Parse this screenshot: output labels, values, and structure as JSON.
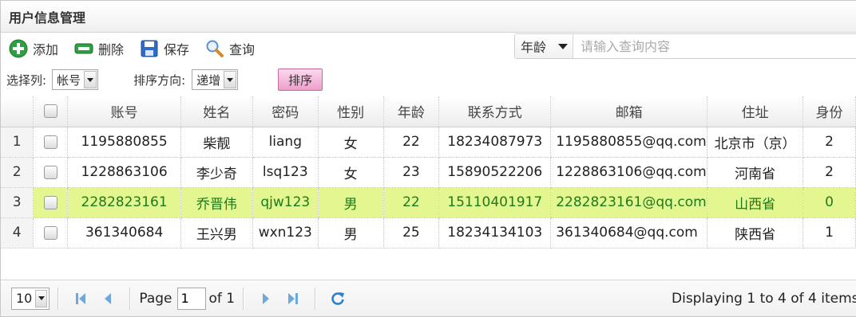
{
  "panel": {
    "title": "用户信息管理"
  },
  "toolbar": {
    "add_label": "添加",
    "delete_label": "删除",
    "save_label": "保存",
    "query_label": "查询"
  },
  "search": {
    "field_value": "年龄",
    "placeholder": "请输入查询内容"
  },
  "sortbar": {
    "column_label": "选择列:",
    "column_value": "帐号",
    "direction_label": "排序方向:",
    "direction_value": "递增",
    "sort_button": "排序"
  },
  "grid": {
    "columns": [
      "账号",
      "姓名",
      "密码",
      "性别",
      "年龄",
      "联系方式",
      "邮箱",
      "住址",
      "身份"
    ],
    "rows": [
      {
        "num": "1",
        "account": "1195880855",
        "name": "柴靓",
        "password": "liang",
        "gender": "女",
        "age": "22",
        "phone": "18234087973",
        "email": "1195880855@qq.com",
        "address": "北京市（京）",
        "role": "2",
        "selected": false
      },
      {
        "num": "2",
        "account": "1228863106",
        "name": "李少奇",
        "password": "lsq123",
        "gender": "女",
        "age": "23",
        "phone": "15890522206",
        "email": "1228863106@qq.com",
        "address": "河南省",
        "role": "2",
        "selected": false
      },
      {
        "num": "3",
        "account": "2282823161",
        "name": "乔晋伟",
        "password": "qjw123",
        "gender": "男",
        "age": "22",
        "phone": "15110401917",
        "email": "2282823161@qq.com",
        "address": "山西省",
        "role": "0",
        "selected": true
      },
      {
        "num": "4",
        "account": "361340684",
        "name": "王兴男",
        "password": "wxn123",
        "gender": "男",
        "age": "25",
        "phone": "18234134103",
        "email": "361340684@qq.com",
        "address": "陕西省",
        "role": "1",
        "selected": false
      }
    ]
  },
  "pager": {
    "page_size": "10",
    "page_label": "Page",
    "page_value": "1",
    "of_label": "of 1",
    "display_text": "Displaying 1 to 4 of 4 items"
  },
  "colors": {
    "selected_row_bg": "#e3f68f",
    "selected_row_text": "#1c7c1c",
    "sort_button_bg": "#ee9fcb",
    "nav_icon_color": "#6fa8dc",
    "refresh_icon_color": "#2a7fd1"
  },
  "icons": {
    "add": "green-plus-icon",
    "delete": "green-minus-icon",
    "save": "floppy-disk-icon",
    "query": "magnifier-icon",
    "first": "first-page-icon",
    "prev": "prev-page-icon",
    "next": "next-page-icon",
    "last": "last-page-icon",
    "refresh": "refresh-icon"
  }
}
